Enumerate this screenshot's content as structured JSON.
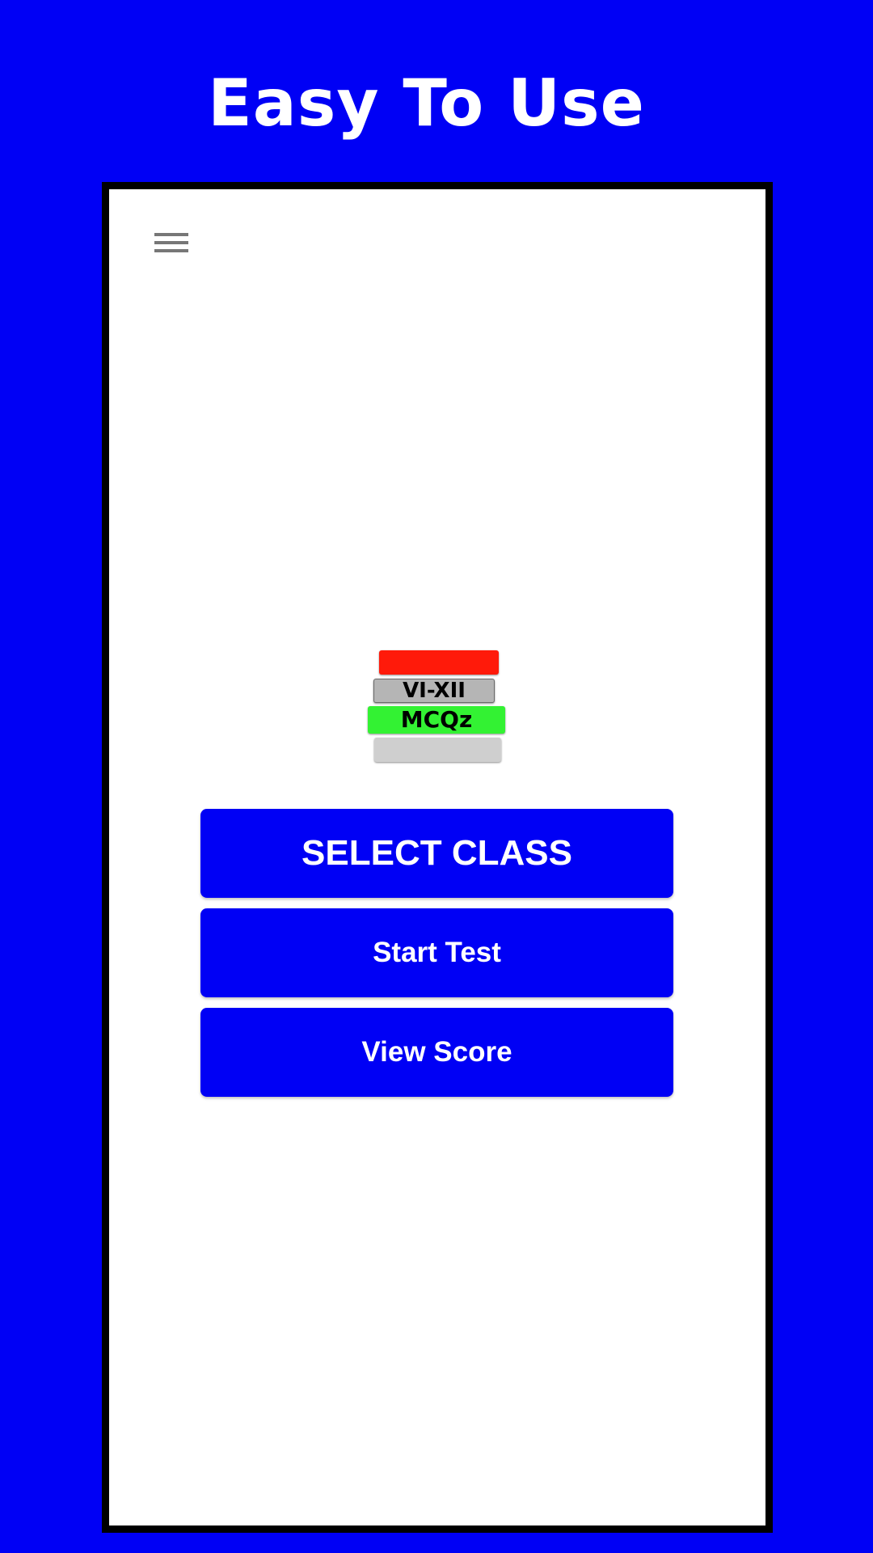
{
  "banner": {
    "title": "Easy To Use"
  },
  "app": {
    "menu_icon": "hamburger-menu-icon",
    "logo": {
      "line1": "VI-XII",
      "line2": "MCQz",
      "colors": {
        "top_block": "#ff1a0a",
        "middle_block": "#b5b5b5",
        "green_block": "#33f233",
        "bottom_block": "#cfcfcf"
      }
    },
    "buttons": {
      "select_class": "SELECT CLASS",
      "start_test": "Start Test",
      "view_score": "View Score"
    }
  },
  "colors": {
    "background": "#0000f5",
    "button": "#0000f5",
    "button_text": "#ffffff",
    "screen": "#ffffff",
    "frame": "#000000"
  }
}
